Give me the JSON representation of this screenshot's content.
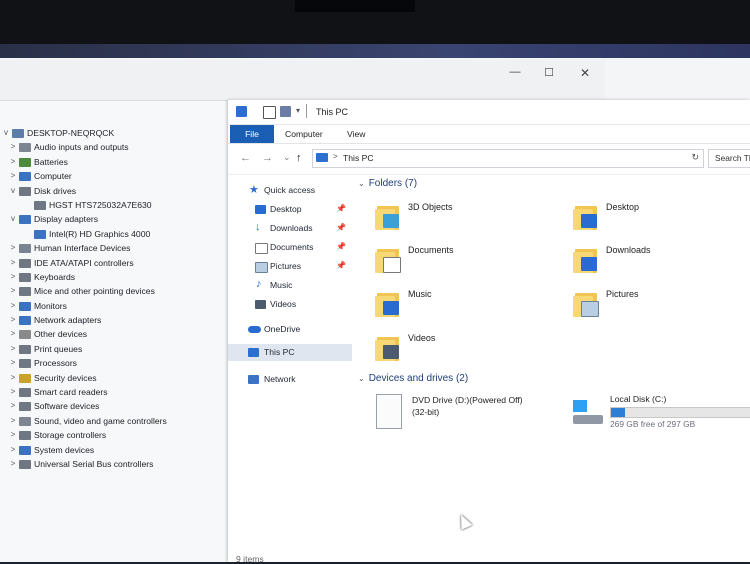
{
  "device_manager": {
    "controls": {
      "minimize": "—",
      "maximize": "☐",
      "close": "✕"
    },
    "tree": [
      {
        "label": "DESKTOP-NEQRQCK",
        "level": 0,
        "expander": "v",
        "icon": "computer-icon",
        "color": "#5b7fa8"
      },
      {
        "label": "Audio inputs and outputs",
        "level": 1,
        "expander": ">",
        "icon": "speaker-icon",
        "color": "#7d8590"
      },
      {
        "label": "Batteries",
        "level": 1,
        "expander": ">",
        "icon": "battery-icon",
        "color": "#4d8a3c"
      },
      {
        "label": "Computer",
        "level": 1,
        "expander": ">",
        "icon": "monitor-icon",
        "color": "#3b73c2"
      },
      {
        "label": "Disk drives",
        "level": 1,
        "expander": "v",
        "icon": "disk-icon",
        "color": "#6f7782"
      },
      {
        "label": "HGST HTS725032A7E630",
        "level": 2,
        "expander": "",
        "icon": "disk-icon",
        "color": "#6f7782"
      },
      {
        "label": "Display adapters",
        "level": 1,
        "expander": "v",
        "icon": "display-adapter-icon",
        "color": "#3b73c2"
      },
      {
        "label": "Intel(R) HD Graphics 4000",
        "level": 2,
        "expander": "",
        "icon": "display-adapter-icon",
        "color": "#3b73c2"
      },
      {
        "label": "Human Interface Devices",
        "level": 1,
        "expander": ">",
        "icon": "hid-icon",
        "color": "#7a8391"
      },
      {
        "label": "IDE ATA/ATAPI controllers",
        "level": 1,
        "expander": ">",
        "icon": "ide-icon",
        "color": "#6f7782"
      },
      {
        "label": "Keyboards",
        "level": 1,
        "expander": ">",
        "icon": "keyboard-icon",
        "color": "#6f7782"
      },
      {
        "label": "Mice and other pointing devices",
        "level": 1,
        "expander": ">",
        "icon": "mouse-icon",
        "color": "#6f7782"
      },
      {
        "label": "Monitors",
        "level": 1,
        "expander": ">",
        "icon": "monitor-icon",
        "color": "#3b73c2"
      },
      {
        "label": "Network adapters",
        "level": 1,
        "expander": ">",
        "icon": "network-icon",
        "color": "#3b73c2"
      },
      {
        "label": "Other devices",
        "level": 1,
        "expander": ">",
        "icon": "other-device-icon",
        "color": "#8a8a8a"
      },
      {
        "label": "Print queues",
        "level": 1,
        "expander": ">",
        "icon": "printer-icon",
        "color": "#6f7782"
      },
      {
        "label": "Processors",
        "level": 1,
        "expander": ">",
        "icon": "processor-icon",
        "color": "#6f7782"
      },
      {
        "label": "Security devices",
        "level": 1,
        "expander": ">",
        "icon": "security-icon",
        "color": "#c9a227"
      },
      {
        "label": "Smart card readers",
        "level": 1,
        "expander": ">",
        "icon": "smart-card-icon",
        "color": "#6f7782"
      },
      {
        "label": "Software devices",
        "level": 1,
        "expander": ">",
        "icon": "software-icon",
        "color": "#6f7782"
      },
      {
        "label": "Sound, video and game controllers",
        "level": 1,
        "expander": ">",
        "icon": "sound-icon",
        "color": "#7d8590"
      },
      {
        "label": "Storage controllers",
        "level": 1,
        "expander": ">",
        "icon": "storage-icon",
        "color": "#6f7782"
      },
      {
        "label": "System devices",
        "level": 1,
        "expander": ">",
        "icon": "system-icon",
        "color": "#3b73c2"
      },
      {
        "label": "Universal Serial Bus controllers",
        "level": 1,
        "expander": ">",
        "icon": "usb-icon",
        "color": "#6f7782"
      }
    ]
  },
  "explorer": {
    "title": "This PC",
    "ribbon_tabs": {
      "file": "File",
      "computer": "Computer",
      "view": "View"
    },
    "nav_buttons": {
      "back": "←",
      "forward": "→",
      "recent": "⌄",
      "up": "↑"
    },
    "address": {
      "separator": ">",
      "path": "This PC",
      "refresh": "↻"
    },
    "search_placeholder": "Search Th",
    "nav_pane": {
      "quick_access": "Quick access",
      "desktop": "Desktop",
      "downloads": "Downloads",
      "documents": "Documents",
      "pictures": "Pictures",
      "music": "Music",
      "videos": "Videos",
      "onedrive": "OneDrive",
      "this_pc": "This PC",
      "network": "Network",
      "pin": "📌"
    },
    "folders_header": "Folders (7)",
    "folders": {
      "objects3d": "3D Objects",
      "desktop": "Desktop",
      "documents": "Documents",
      "downloads": "Downloads",
      "music": "Music",
      "pictures": "Pictures",
      "videos": "Videos"
    },
    "drives_header": "Devices and drives (2)",
    "drives": {
      "dvd_name": "DVD Drive (D:)(Powered Off)",
      "dvd_sub": "(32-bit)",
      "local_name": "Local Disk (C:)",
      "local_free": "269 GB free of 297 GB",
      "local_used_fraction": 0.094
    },
    "status": "9 items",
    "colors": {
      "accent": "#1b5fb5",
      "folder": "#f2c553",
      "selection": "#dfe6f0"
    }
  }
}
